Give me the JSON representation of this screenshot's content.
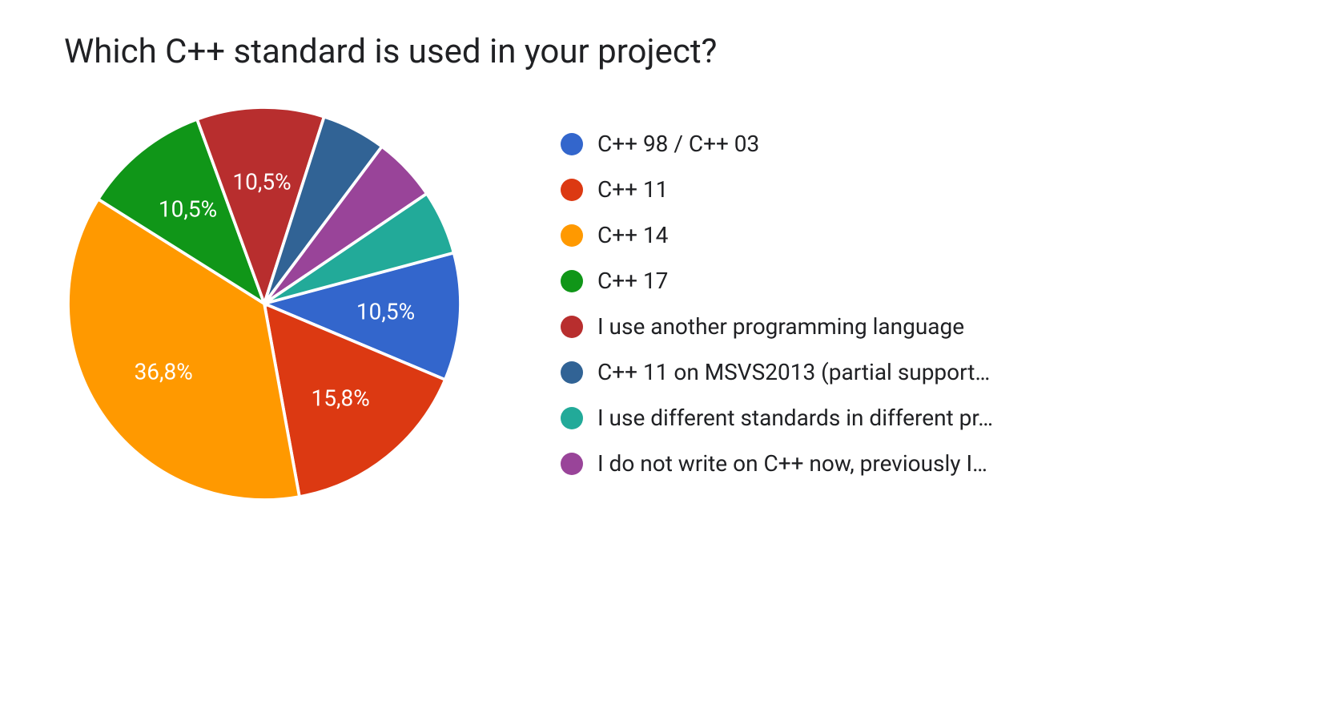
{
  "chart_data": {
    "type": "pie",
    "title": "Which C++ standard is used in your project?",
    "series": [
      {
        "name": "C++ 98 / C++ 03",
        "value": 10.5,
        "color": "#3366cc",
        "show_label": true
      },
      {
        "name": "C++ 11",
        "value": 15.8,
        "color": "#dc3912",
        "show_label": true
      },
      {
        "name": "C++ 14",
        "value": 36.8,
        "color": "#ff9900",
        "show_label": true
      },
      {
        "name": "C++ 17",
        "value": 10.5,
        "color": "#109618",
        "show_label": true
      },
      {
        "name": "I use another programming language",
        "value": 10.5,
        "color": "#b82e2e",
        "show_label": true
      },
      {
        "name": "C++ 11 on MSVS2013 (partial support…",
        "value": 5.3,
        "color": "#316395",
        "show_label": false
      },
      {
        "name": "I use different standards in different pr…",
        "value": 5.3,
        "color": "#22aa99",
        "show_label": false
      },
      {
        "name": "I do not write on C++ now, previously I…",
        "value": 5.3,
        "color": "#994499",
        "show_label": false
      }
    ],
    "legend_position": "right",
    "pie_order": [
      0,
      1,
      2,
      3,
      4,
      5,
      7,
      6
    ],
    "label_format": "comma_decimal"
  }
}
